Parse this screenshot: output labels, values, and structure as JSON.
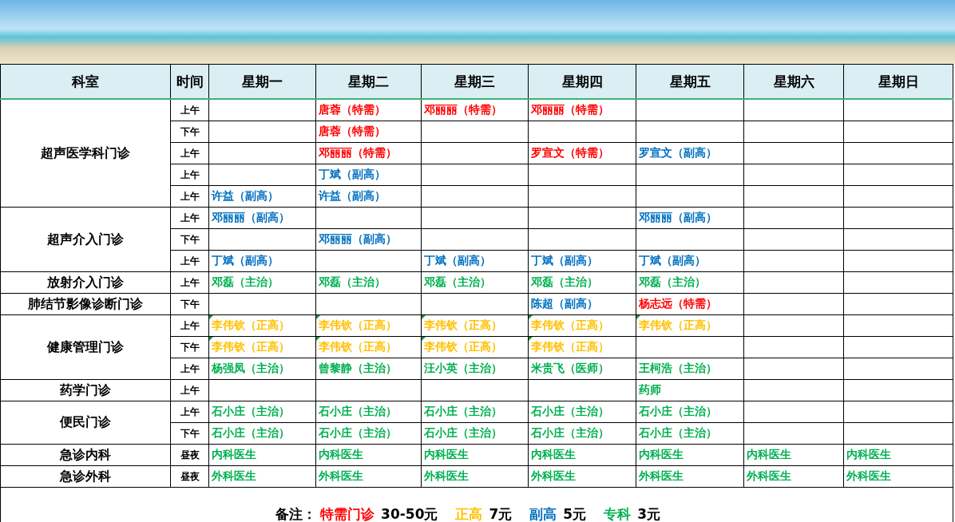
{
  "header": {
    "department": "科室",
    "time": "时间",
    "days": [
      "星期一",
      "星期二",
      "星期三",
      "星期四",
      "星期五",
      "星期六",
      "星期日"
    ]
  },
  "departments": [
    {
      "name": "超声医学科门诊",
      "slots": [
        {
          "time": "上午",
          "cells": [
            null,
            {
              "text": "唐蓉（特需）",
              "color": "#ff0000",
              "marked": false
            },
            {
              "text": "邓丽丽（特需）",
              "color": "#ff0000",
              "marked": false
            },
            {
              "text": "邓丽丽（特需）",
              "color": "#ff0000",
              "marked": false
            },
            null,
            null,
            null
          ]
        },
        {
          "time": "下午",
          "cells": [
            null,
            {
              "text": "唐蓉（特需）",
              "color": "#ff0000",
              "marked": false
            },
            null,
            null,
            null,
            null,
            null
          ]
        },
        {
          "time": "上午",
          "cells": [
            null,
            {
              "text": "邓丽丽（特需）",
              "color": "#ff0000",
              "marked": false
            },
            null,
            {
              "text": "罗宣文（特需）",
              "color": "#ff0000",
              "marked": false
            },
            {
              "text": "罗宣文（副高）",
              "color": "#0070c0",
              "marked": false
            },
            null,
            null
          ]
        },
        {
          "time": "上午",
          "cells": [
            null,
            {
              "text": "丁斌（副高）",
              "color": "#0070c0",
              "marked": false
            },
            null,
            null,
            null,
            null,
            null
          ]
        },
        {
          "time": "上午",
          "cells": [
            {
              "text": "许益（副高）",
              "color": "#0070c0",
              "marked": false
            },
            {
              "text": "许益（副高）",
              "color": "#0070c0",
              "marked": false
            },
            null,
            null,
            null,
            null,
            null
          ]
        }
      ]
    },
    {
      "name": "超声介入门诊",
      "slots": [
        {
          "time": "上午",
          "cells": [
            {
              "text": "邓丽丽（副高）",
              "color": "#0070c0",
              "marked": false
            },
            null,
            null,
            null,
            {
              "text": "邓丽丽（副高）",
              "color": "#0070c0",
              "marked": false
            },
            null,
            null
          ]
        },
        {
          "time": "下午",
          "cells": [
            null,
            {
              "text": "邓丽丽（副高）",
              "color": "#0070c0",
              "marked": false
            },
            null,
            null,
            null,
            null,
            null
          ]
        },
        {
          "time": "上午",
          "cells": [
            {
              "text": "丁斌（副高）",
              "color": "#0070c0",
              "marked": false
            },
            null,
            {
              "text": "丁斌（副高）",
              "color": "#0070c0",
              "marked": false
            },
            {
              "text": "丁斌（副高）",
              "color": "#0070c0",
              "marked": false
            },
            {
              "text": "丁斌（副高）",
              "color": "#0070c0",
              "marked": false
            },
            null,
            null
          ]
        }
      ]
    },
    {
      "name": "放射介入门诊",
      "slots": [
        {
          "time": "上午",
          "cells": [
            {
              "text": "邓磊（主治）",
              "color": "#00b050",
              "marked": false
            },
            {
              "text": "邓磊（主治）",
              "color": "#00b050",
              "marked": false
            },
            {
              "text": "邓磊（主治）",
              "color": "#00b050",
              "marked": false
            },
            {
              "text": "邓磊（主治）",
              "color": "#00b050",
              "marked": false
            },
            {
              "text": "邓磊（主治）",
              "color": "#00b050",
              "marked": false
            },
            null,
            null
          ]
        }
      ]
    },
    {
      "name": "肺结节影像诊断门诊",
      "slots": [
        {
          "time": "下午",
          "cells": [
            null,
            null,
            null,
            {
              "text": "陈超（副高）",
              "color": "#0070c0",
              "marked": false
            },
            {
              "text": "杨志远（特需）",
              "color": "#ff0000",
              "marked": false
            },
            null,
            null
          ]
        }
      ]
    },
    {
      "name": "健康管理门诊",
      "slots": [
        {
          "time": "上午",
          "cells": [
            {
              "text": "李伟钦（正高）",
              "color": "#ffc000",
              "marked": true
            },
            {
              "text": "李伟钦（正高）",
              "color": "#ffc000",
              "marked": true
            },
            {
              "text": "李伟钦（正高）",
              "color": "#ffc000",
              "marked": true
            },
            {
              "text": "李伟钦（正高）",
              "color": "#ffc000",
              "marked": true
            },
            {
              "text": "李伟钦（正高）",
              "color": "#ffc000",
              "marked": true
            },
            null,
            null
          ]
        },
        {
          "time": "下午",
          "cells": [
            {
              "text": "李伟钦（正高）",
              "color": "#ffc000",
              "marked": true
            },
            {
              "text": "李伟钦（正高）",
              "color": "#ffc000",
              "marked": true
            },
            {
              "text": "李伟钦（正高）",
              "color": "#ffc000",
              "marked": true
            },
            {
              "text": "李伟钦（正高）",
              "color": "#ffc000",
              "marked": true
            },
            null,
            null,
            null
          ]
        },
        {
          "time": "上午",
          "cells": [
            {
              "text": "杨强凤（主治）",
              "color": "#00b050",
              "marked": false
            },
            {
              "text": "曾黎静（主治）",
              "color": "#00b050",
              "marked": false
            },
            {
              "text": "汪小英（主治）",
              "color": "#00b050",
              "marked": false
            },
            {
              "text": "米贵飞（医师）",
              "color": "#00b050",
              "marked": false
            },
            {
              "text": "王柯浩（主治）",
              "color": "#00b050",
              "marked": false
            },
            null,
            null
          ]
        }
      ]
    },
    {
      "name": "药学门诊",
      "slots": [
        {
          "time": "上午",
          "cells": [
            null,
            null,
            null,
            null,
            {
              "text": "药师",
              "color": "#00b050",
              "marked": false
            },
            null,
            null
          ]
        }
      ]
    },
    {
      "name": "便民门诊",
      "slots": [
        {
          "time": "上午",
          "cells": [
            {
              "text": "石小庄（主治）",
              "color": "#00b050",
              "marked": false
            },
            {
              "text": "石小庄（主治）",
              "color": "#00b050",
              "marked": false
            },
            {
              "text": "石小庄（主治）",
              "color": "#00b050",
              "marked": false
            },
            {
              "text": "石小庄（主治）",
              "color": "#00b050",
              "marked": false
            },
            {
              "text": "石小庄（主治）",
              "color": "#00b050",
              "marked": false
            },
            null,
            null
          ]
        },
        {
          "time": "下午",
          "cells": [
            {
              "text": "石小庄（主治）",
              "color": "#00b050",
              "marked": false
            },
            {
              "text": "石小庄（主治）",
              "color": "#00b050",
              "marked": false
            },
            {
              "text": "石小庄（主治）",
              "color": "#00b050",
              "marked": false
            },
            {
              "text": "石小庄（主治）",
              "color": "#00b050",
              "marked": false
            },
            {
              "text": "石小庄（主治）",
              "color": "#00b050",
              "marked": false
            },
            null,
            null
          ]
        }
      ]
    },
    {
      "name": "急诊内科",
      "slots": [
        {
          "time": "昼夜",
          "cells": [
            {
              "text": "内科医生",
              "color": "#00b050",
              "marked": false
            },
            {
              "text": "内科医生",
              "color": "#00b050",
              "marked": false
            },
            {
              "text": "内科医生",
              "color": "#00b050",
              "marked": false
            },
            {
              "text": "内科医生",
              "color": "#00b050",
              "marked": false
            },
            {
              "text": "内科医生",
              "color": "#00b050",
              "marked": false
            },
            {
              "text": "内科医生",
              "color": "#00b050",
              "marked": false
            },
            {
              "text": "内科医生",
              "color": "#00b050",
              "marked": false
            }
          ]
        }
      ]
    },
    {
      "name": "急诊外科",
      "slots": [
        {
          "time": "昼夜",
          "cells": [
            {
              "text": "外科医生",
              "color": "#00b050",
              "marked": false
            },
            {
              "text": "外科医生",
              "color": "#00b050",
              "marked": false
            },
            {
              "text": "外科医生",
              "color": "#00b050",
              "marked": false
            },
            {
              "text": "外科医生",
              "color": "#00b050",
              "marked": false
            },
            {
              "text": "外科医生",
              "color": "#00b050",
              "marked": false
            },
            {
              "text": "外科医生",
              "color": "#00b050",
              "marked": false
            },
            {
              "text": "外科医生",
              "color": "#00b050",
              "marked": false
            }
          ]
        }
      ]
    }
  ],
  "note": {
    "label": "备注：",
    "fees": [
      {
        "name": "特需门诊",
        "color": "#ff0000",
        "price": "30-50元"
      },
      {
        "name": "正高",
        "color": "#ffc000",
        "price": "7元"
      },
      {
        "name": "副高",
        "color": "#0070c0",
        "price": "5元"
      },
      {
        "name": "专科",
        "color": "#00b050",
        "price": "3元"
      }
    ]
  }
}
